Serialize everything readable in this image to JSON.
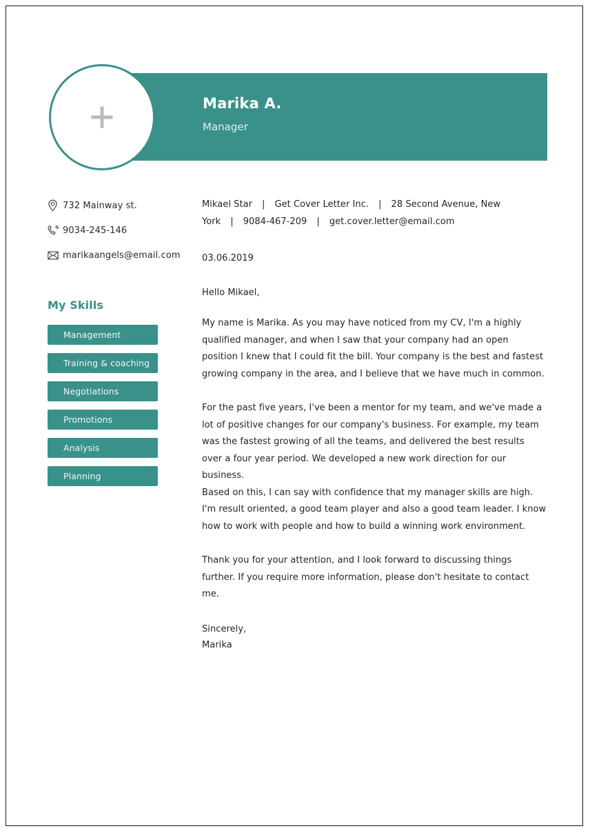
{
  "header": {
    "name": "Marika A.",
    "job_title": "Manager",
    "photo_placeholder_icon": "plus-icon",
    "accent_color": "#3a918a"
  },
  "sidebar": {
    "contacts": [
      {
        "icon": "location-pin-icon",
        "text": "732 Mainway st."
      },
      {
        "icon": "phone-icon",
        "text": "9034-245-146"
      },
      {
        "icon": "envelope-icon",
        "text": "marikaangels@email.com"
      }
    ],
    "skills_title": "My Skills",
    "skills": [
      "Management",
      "Training & coaching",
      "Negotiations",
      "Promotions",
      "Analysis",
      "Planning"
    ]
  },
  "letter": {
    "recipient": {
      "name": "Mikael Star",
      "company": "Get Cover Letter Inc.",
      "address": "28 Second Avenue, New York",
      "phone": "9084-467-209",
      "email": "get.cover.letter@email.com",
      "separator": "|"
    },
    "date": "03.06.2019",
    "salutation": "Hello Mikael,",
    "paragraphs": [
      "My name is Marika. As you may have noticed from my CV, I'm a highly qualified manager, and when I saw that your company had an open position I knew that I could fit the bill. Your company is the best and fastest growing company in the area, and I believe that we have much in common.",
      "For the past five years, I've been a mentor for my team, and we've made a lot of positive changes for our company's business. For example, my team was the fastest growing of all the teams, and delivered the best results over a four year period. We developed a new work direction for our business.",
      "Based on this, I can say with confidence that my manager skills are high. I'm result oriented, a good team player and also a good team leader. I know how to work with people and how to build a winning work environment.",
      "Thank you for your attention, and I look forward to discussing things further. If you require more information, please don't hesitate to contact me."
    ],
    "closing": "Sincerely,",
    "signature": "Marika"
  }
}
